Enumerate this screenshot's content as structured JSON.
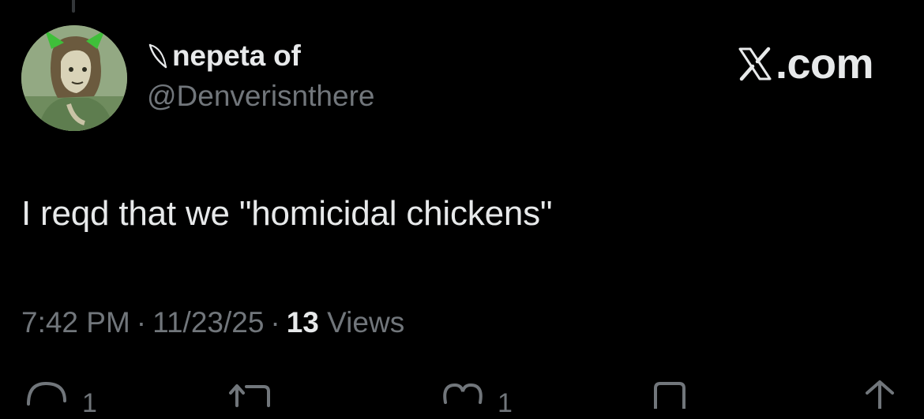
{
  "post": {
    "display_name": "nepeta of",
    "name_badge_icon": "leaf-icon",
    "handle": "@Denverisnthere",
    "text": "I reqd that we \"homicidal chickens\"",
    "time": "7:42 PM",
    "date": "11/23/25",
    "views_count": "13",
    "views_label": "Views",
    "separator": "·"
  },
  "watermark": {
    "text": ".com",
    "icon": "x-logo-icon"
  },
  "actions": {
    "reply_count": "1",
    "like_count": "1",
    "icons": [
      "reply-icon",
      "repost-icon",
      "like-icon",
      "bookmark-icon",
      "share-icon"
    ]
  },
  "colors": {
    "background": "#000000",
    "primary_text": "#e7e9ea",
    "secondary_text": "#71767b",
    "thread_line": "#333639"
  }
}
